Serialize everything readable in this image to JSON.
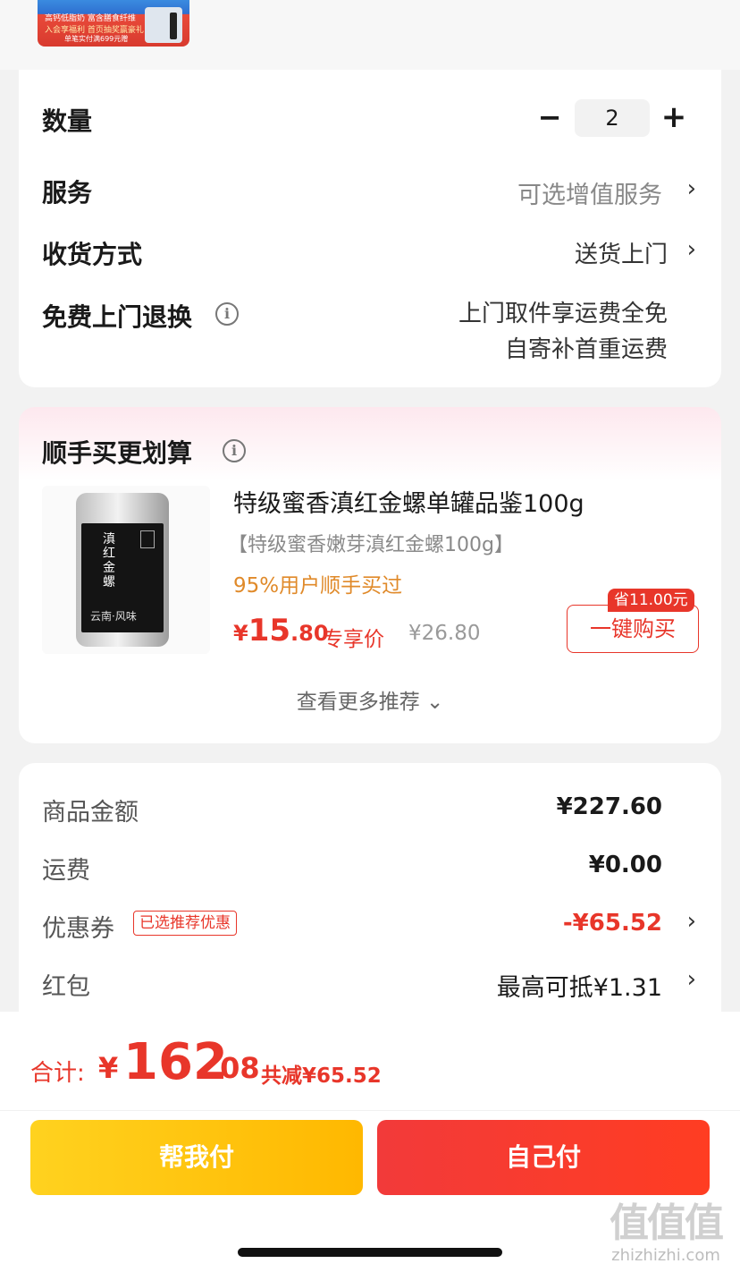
{
  "banner": {
    "line1": "高钙低脂奶  富含膳食纤维",
    "line2": "入会享福利  首页抽奖赢豪礼",
    "line3": "单笔实付满699元赠"
  },
  "order_options": {
    "quantity_label": "数量",
    "quantity_value": "2",
    "minus_symbol": "−",
    "plus_symbol": "+",
    "service_label": "服务",
    "service_value": "可选增值服务",
    "delivery_label": "收货方式",
    "delivery_value": "送货上门",
    "return_label": "免费上门退换",
    "return_value_line1": "上门取件享运费全免",
    "return_value_line2": "自寄补首重运费",
    "chevron": "›",
    "info_symbol": "i"
  },
  "recommendation": {
    "title": "顺手买更划算",
    "product_name": "特级蜜香滇红金螺单罐品鉴100g",
    "product_spec": "【特级蜜香嫩芽滇红金螺100g】",
    "bought_text": "95%用户顺手买过",
    "price_currency": "¥",
    "price_int": "15",
    "price_dec": ".80",
    "price_tag": "专享价",
    "original_price": "¥26.80",
    "save_badge": "省11.00元",
    "buy_button": "一键购买",
    "more_link": "查看更多推荐 ⌄",
    "can_title": "滇红金螺",
    "can_subtitle": "云南·风味"
  },
  "summary": {
    "goods_label": "商品金额",
    "goods_value": "¥227.60",
    "shipping_label": "运费",
    "shipping_value": "¥0.00",
    "coupon_label": "优惠券",
    "coupon_tag": "已选推荐优惠",
    "coupon_value": "-¥65.52",
    "redpacket_label": "红包",
    "redpacket_value": "最高可抵¥1.31"
  },
  "checkout": {
    "total_label": "合计:",
    "total_currency": "¥",
    "total_int": "162",
    "total_dec": ".08",
    "total_saved": "共减¥65.52",
    "help_pay_button": "帮我付",
    "self_pay_button": "自己付"
  },
  "watermark": {
    "main": "值值值",
    "sub": "zhizhizhi.com"
  },
  "colors": {
    "accent_red": "#e8362a",
    "accent_yellow": "#ffb800",
    "orange_text": "#e08a2a"
  }
}
